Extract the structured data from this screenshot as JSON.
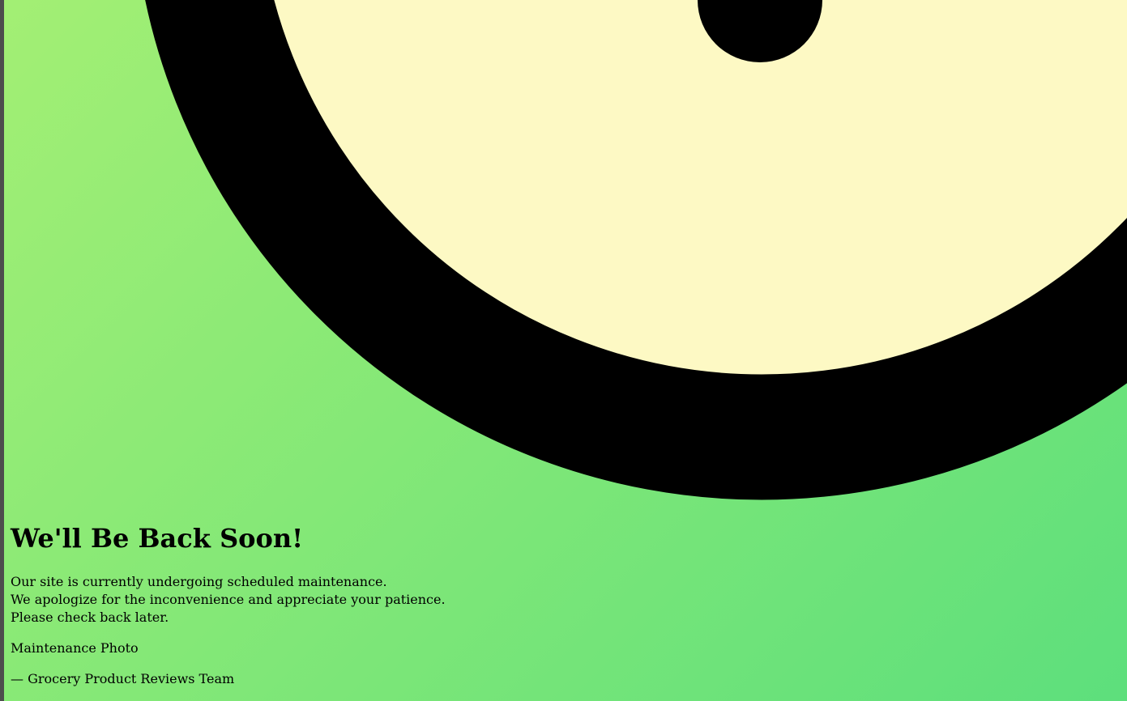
{
  "heading": "We'll Be Back Soon!",
  "message": {
    "line1": "Our site is currently undergoing scheduled maintenance.",
    "line2": "We apologize for the inconvenience and appreciate your patience.",
    "line3": "Please check back later."
  },
  "photo_alt": "Maintenance Photo",
  "signature": "— Grocery Product Reviews Team",
  "colors": {
    "background_start": "#a3ef74",
    "background_end": "#5ddf7c",
    "illustration_fill": "#fdf9c4",
    "illustration_stroke": "#000000",
    "text": "#000000"
  },
  "icons": {
    "illustration": "maintenance-illustration"
  }
}
